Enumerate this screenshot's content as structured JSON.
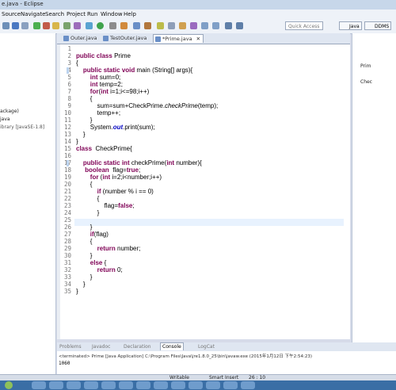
{
  "window": {
    "title": "e.java - Eclipse"
  },
  "menu": [
    "Source",
    "Navigate",
    "Search",
    "Project",
    "Run",
    "Window",
    "Help"
  ],
  "toolbar": {
    "quick_access": "Quick Access",
    "perspectives": [
      "Java",
      "DDMS"
    ]
  },
  "left_pane": {
    "items": [
      "ackage)",
      "java",
      "ibrary [JavaSE-1.8]"
    ]
  },
  "editor_tabs": [
    {
      "label": "Outer.java",
      "active": false
    },
    {
      "label": "TestOuter.java",
      "active": false
    },
    {
      "label": "*Prime.java",
      "active": true
    }
  ],
  "code": {
    "line_numbers": [
      "1",
      "2",
      "3",
      "4",
      "5",
      "6",
      "7",
      "8",
      "9",
      "10",
      "11",
      "12",
      "13",
      "14",
      "15",
      "16",
      "17",
      "18",
      "19",
      "20",
      "21",
      "22",
      "23",
      "24",
      "25",
      "26",
      "27",
      "28",
      "29",
      "30",
      "31",
      "32",
      "33",
      "34",
      "35"
    ],
    "lines": [
      "",
      "public class Prime",
      "{",
      "    public static void main (String[] args){",
      "        int sum=0;",
      "        int temp=2;",
      "        for(int i=1;i<=98;i++)",
      "        {",
      "            sum=sum+CheckPrime.checkPrime(temp);",
      "            temp++;",
      "        }",
      "        System.out.print(sum);",
      "    }",
      "}",
      "class  CheckPrime{",
      "",
      "    public static int checkPrime(int number){",
      "     boolean  flag=true;",
      "        for (int i=2;i<number;i++)",
      "        {",
      "            if (number % i == 0)",
      "            {",
      "                flag=false;",
      "            }",
      "",
      "        }",
      "        if(flag)",
      "        {",
      "            return number;",
      "        }",
      "        else {",
      "            return 0;",
      "        }",
      "    }",
      "}"
    ]
  },
  "right_pane": {
    "items": [
      "Prim",
      "Chec"
    ]
  },
  "bottom_panel": {
    "tabs": [
      "Problems",
      "Javadoc",
      "Declaration",
      "Console",
      "LogCat"
    ],
    "active_tab": "Console",
    "terminated": "<terminated> Prime [Java Application] C:\\Program Files\\Java\\jre1.8.0_25\\bin\\javaw.exe (2015年1月12日 下午2:54:23)",
    "output": "1060"
  },
  "status_bar": {
    "writable": "Writable",
    "insert_mode": "Smart Insert",
    "position": "26 : 10"
  }
}
